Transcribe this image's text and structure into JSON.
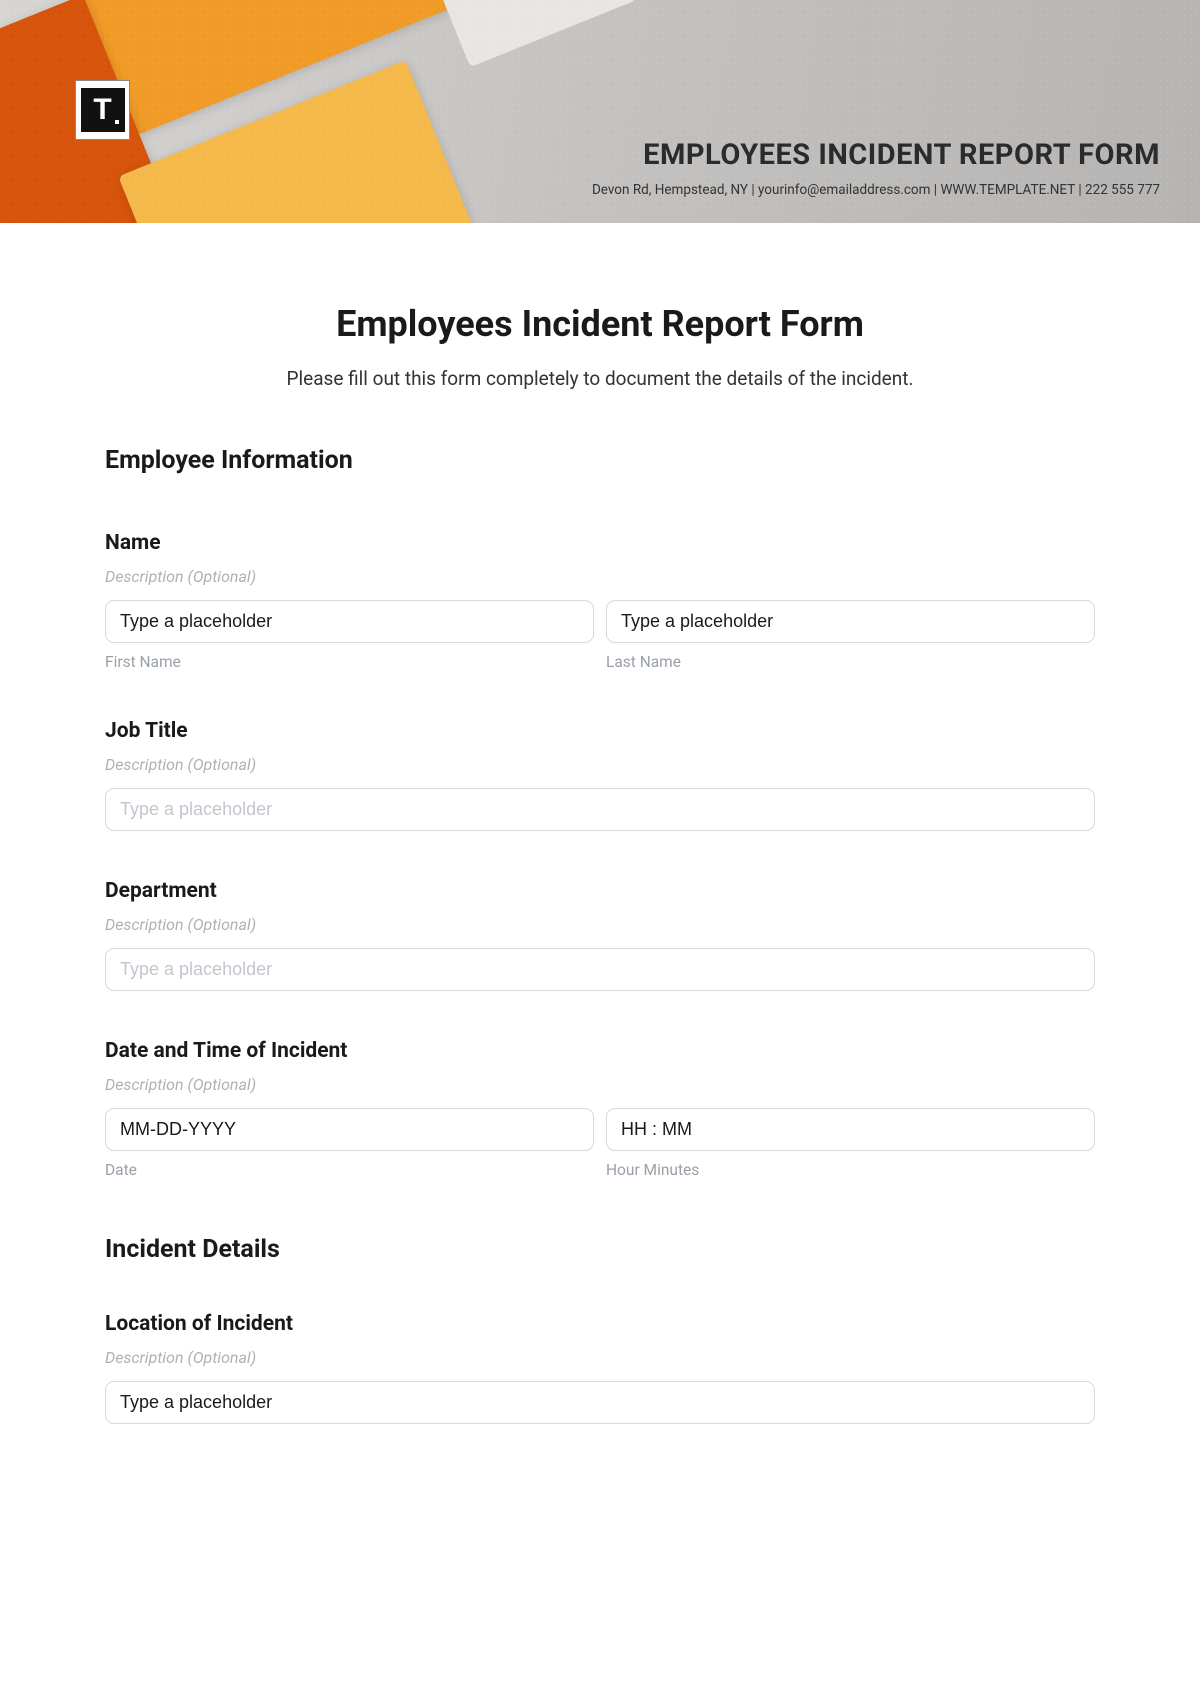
{
  "header": {
    "logo_letter": "T",
    "title": "EMPLOYEES INCIDENT REPORT FORM",
    "subline": "Devon Rd, Hempstead, NY | yourinfo@emailaddress.com | WWW.TEMPLATE.NET | 222 555 777"
  },
  "form": {
    "title": "Employees Incident Report Form",
    "subtitle": "Please fill out this form completely to document the details of the incident."
  },
  "sections": {
    "employee_info": {
      "heading": "Employee Information",
      "name": {
        "label": "Name",
        "desc": "Description (Optional)",
        "first_value": "Type a placeholder",
        "last_value": "Type a placeholder",
        "first_sub": "First Name",
        "last_sub": "Last Name"
      },
      "job_title": {
        "label": "Job Title",
        "desc": "Description (Optional)",
        "placeholder": "Type a placeholder"
      },
      "department": {
        "label": "Department",
        "desc": "Description (Optional)",
        "placeholder": "Type a placeholder"
      },
      "datetime": {
        "label": "Date and Time of Incident",
        "desc": "Description (Optional)",
        "date_value": "MM-DD-YYYY",
        "time_value": "HH : MM",
        "date_sub": "Date",
        "time_sub": "Hour Minutes"
      }
    },
    "incident_details": {
      "heading": "Incident Details",
      "location": {
        "label": "Location of Incident",
        "desc": "Description (Optional)",
        "value": "Type a placeholder"
      }
    }
  }
}
